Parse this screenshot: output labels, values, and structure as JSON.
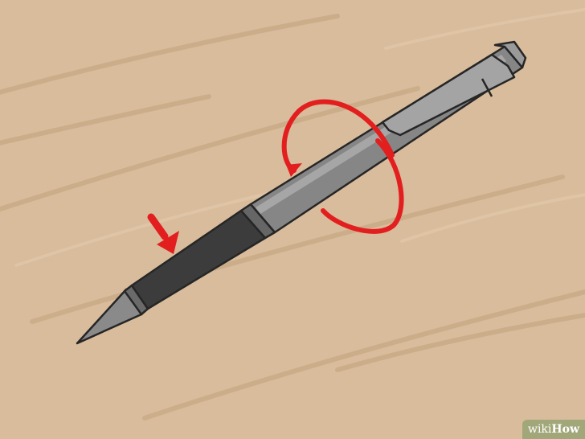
{
  "illustration": {
    "colors": {
      "background": "#d8bc9c",
      "wood_grain": "#c9aa86",
      "barrel": "#868686",
      "grip": "#3c3c3c",
      "tip": "#8a8a8a",
      "clip": "#a4a4a4",
      "outline": "#262626",
      "annotation": "#e31e1e"
    },
    "icons": [
      "pen-illustration",
      "down-arrow-icon",
      "rotation-arrow-icon"
    ]
  },
  "watermark": {
    "part1": "wiki",
    "part2": "How",
    "color": "#76965c"
  }
}
